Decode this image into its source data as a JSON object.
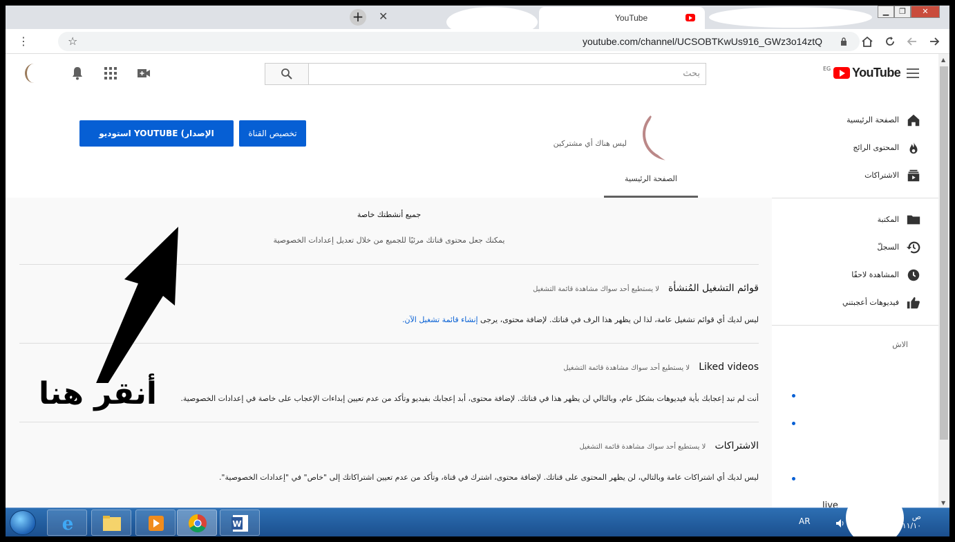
{
  "browser": {
    "active_tab_title": "YouTube",
    "url": "youtube.com/channel/UCSOBTKwUs916_GWz3o14ztQ"
  },
  "masthead": {
    "search_placeholder": "بحث",
    "logo_text": "YouTube",
    "region": "EG"
  },
  "channel": {
    "subscribers": "ليس هناك أي مشتركين",
    "customize_button": "تخصيص القناة",
    "studio_button": "استوديو YOUTUBE (الإصدار التجريبي)",
    "tab_home": "الصفحة الرئيسية"
  },
  "privacy": {
    "title": "جميع أنشطتك خاصة",
    "subtitle": "يمكنك جعل محتوى قناتك مرئيًا للجميع من خلال تعديل إعدادات الخصوصية"
  },
  "sections": [
    {
      "heading": "قوائم التشغيل المُنشأة",
      "note": "لا يستطيع أحد سواك مشاهدة قائمة التشغيل",
      "body": "ليس لديك أي قوائم تشغيل عامة، لذا لن يظهر هذا الرف في قناتك. لإضافة محتوى، يرجى ",
      "link": "إنشاء قائمة تشغيل الآن."
    },
    {
      "heading": "Liked videos",
      "note": "لا يستطيع أحد سواك مشاهدة قائمة التشغيل",
      "body": "أنت لم تبد إعجابك بأية فيديوهات بشكل عام، وبالتالي لن يظهر هذا في قناتك. لإضافة محتوى، أبد إعجابك بفيديو وتأكد من عدم تعيين إبداءات الإعجاب على خاصة في إعدادات الخصوصية."
    },
    {
      "heading": "الاشتراكات",
      "note": "لا يستطيع أحد سواك مشاهدة قائمة التشغيل",
      "body": "ليس لديك أي اشتراكات عامة وبالتالي، لن يظهر المحتوى على قناتك. لإضافة محتوى، اشترك في قناة، وتأكد من عدم تعيين اشتراكاتك إلى \"خاص\" في \"إعدادات الخصوصية\"."
    }
  ],
  "sidebar": {
    "items": [
      {
        "label": "الصفحة الرئيسية",
        "icon": "home-icon"
      },
      {
        "label": "المحتوى الرائج",
        "icon": "trending-icon"
      },
      {
        "label": "الاشتراكات",
        "icon": "subscriptions-icon"
      },
      {
        "label": "المكتبة",
        "icon": "library-icon"
      },
      {
        "label": "السجلّ",
        "icon": "history-icon"
      },
      {
        "label": "المشاهدة لاحقًا",
        "icon": "watch-later-icon"
      },
      {
        "label": "فيديوهات أعجبتني",
        "icon": "liked-icon"
      }
    ],
    "partial_heading": "الاش",
    "partial_item": "live"
  },
  "annotation": {
    "click_here": "أنقر هنا"
  },
  "taskbar": {
    "language": "AR",
    "clock_top": "ص",
    "clock_date": "١١/١٠/"
  },
  "colors": {
    "accent": "#065fd4",
    "brand": "#ff0000"
  }
}
